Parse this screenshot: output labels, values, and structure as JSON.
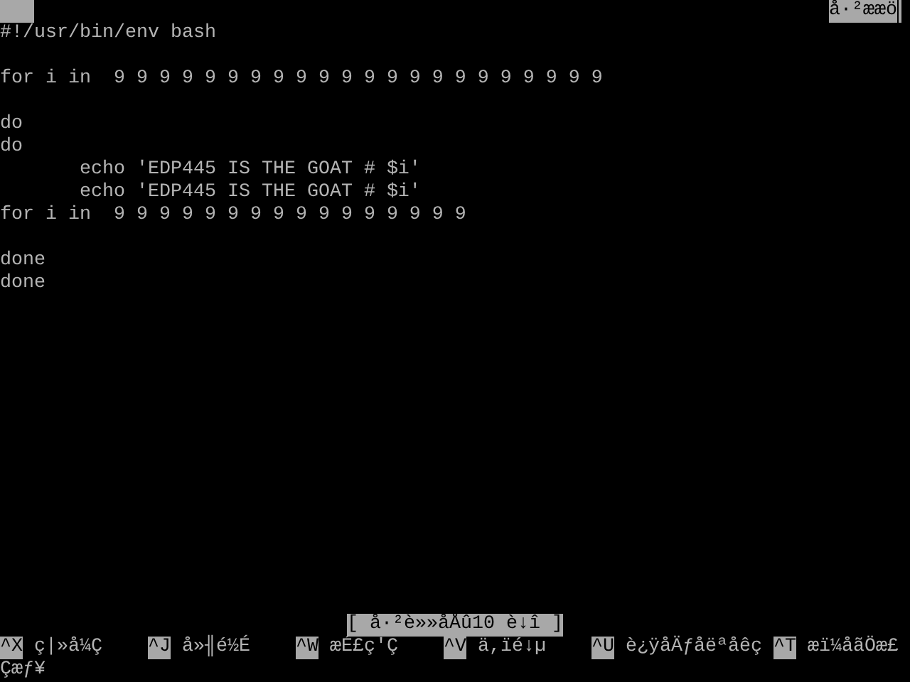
{
  "title_bar": {
    "status": "å·²ææö"
  },
  "lines": [
    {
      "kind": "code",
      "text": "#!/usr/bin/env bash"
    },
    {
      "kind": "blank"
    },
    {
      "kind": "code",
      "text": "for i in  9 9 9 9 9 9 9 9 9 9 9 9 9 9 9 9 9 9 9 9 9 9"
    },
    {
      "kind": "blank"
    },
    {
      "kind": "code",
      "text": "do"
    },
    {
      "kind": "code",
      "text": "do"
    },
    {
      "kind": "code",
      "text": "       echo 'EDP445 IS THE GOAT # $i'"
    },
    {
      "kind": "code",
      "text": "       echo 'EDP445 IS THE GOAT # $i'"
    },
    {
      "kind": "code",
      "text": "for i in  9 9 9 9 9 9 9 9 9 9 9 9 9 9 9 9"
    },
    {
      "kind": "blank"
    },
    {
      "kind": "code",
      "text": "done"
    },
    {
      "kind": "code",
      "text": "done"
    }
  ],
  "status_message": "[ å·²è»»åÅû10 è↓î ]",
  "shortcuts": [
    {
      "key": "^X",
      "label": "ç|»å¼Ç"
    },
    {
      "key": "^J",
      "label": "å»╢é½É"
    },
    {
      "key": "^W",
      "label": "æÉ£ç'Ç"
    },
    {
      "key": "^V",
      "label": "ä,ïé↓µ"
    },
    {
      "key": "^U",
      "label": "è¿ÿåÄƒåëªåêç"
    },
    {
      "key": "^T",
      "label": "æï¼åãÖæ£"
    }
  ],
  "wrapped_text": "Çæƒ¥"
}
